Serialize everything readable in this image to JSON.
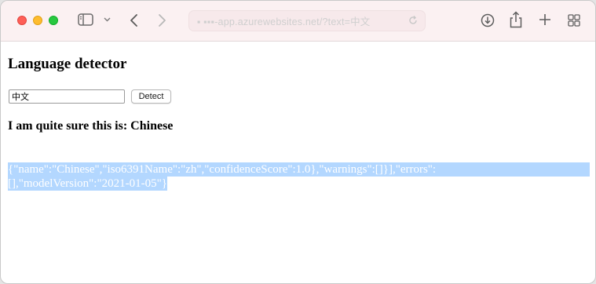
{
  "browser": {
    "address": "▪ ▪▪▪-app.azurewebsites.net/?text=中文"
  },
  "page": {
    "title": "Language detector",
    "input_value": "中文",
    "detect_label": "Detect",
    "result_text": "I am quite sure this is: Chinese",
    "json_line_1": "{\"name\":\"Chinese\",\"iso6391Name\":\"zh\",\"confidenceScore\":1.0},\"warnings\":[]}],\"errors\":",
    "json_line_2": "[],\"modelVersion\":\"2021-01-05\"}"
  },
  "colors": {
    "selection": "#b3d7ff",
    "toolbar": "#fbf1f2"
  },
  "icons": [
    "sidebar-icon",
    "chevron-down-icon",
    "back-icon",
    "forward-icon",
    "lock-icon",
    "reload-icon",
    "download-icon",
    "share-icon",
    "new-tab-icon",
    "tab-overview-icon"
  ]
}
